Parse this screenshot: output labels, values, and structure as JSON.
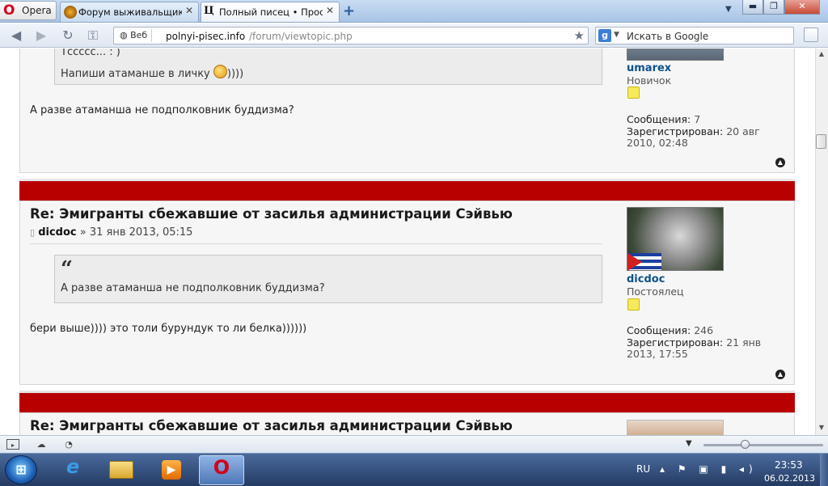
{
  "browser": {
    "menu_label": "Opera",
    "tabs": [
      {
        "title": "Форум выживальщик...",
        "active": false
      },
      {
        "title": "Полный писец • Прос...",
        "active": true
      }
    ],
    "window_controls": {
      "minimize": "▬",
      "restore": "❐",
      "close": "✕"
    },
    "address": {
      "web_label": "Веб",
      "host": "polnyi-pisec.info",
      "path": "/forum/viewtopic.php"
    },
    "search": {
      "placeholder": "Искать в Google"
    }
  },
  "posts": [
    {
      "quote_lines": [
        "Тссссс... : )",
        "Напиши атаманше в личку"
      ],
      "quote_suffix": "))))",
      "body": "А разве атаманша не подполковник буддизма?",
      "author": {
        "name": "umarex",
        "rank": "Новичок",
        "posts_label": "Сообщения:",
        "posts_value": "7",
        "reg_label": "Зарегистрирован:",
        "reg_value": "20 авг 2010, 02:48"
      }
    },
    {
      "title": "Re: Эмигранты сбежавшие от засилья администрации Сэйвью",
      "author_name": "dicdoc",
      "date": "» 31 янв 2013, 05:15",
      "quote_mark": "“",
      "quote": "А разве атаманша не подполковник буддизма?",
      "body": "бери выше)))) это толи бурундук то ли белка))))))",
      "author": {
        "name": "dicdoc",
        "rank": "Постоялец",
        "posts_label": "Сообщения:",
        "posts_value": "246",
        "reg_label": "Зарегистрирован:",
        "reg_value": "21 янв 2013, 17:55"
      }
    },
    {
      "title": "Re: Эмигранты сбежавшие от засилья администрации Сэйвью"
    }
  ],
  "taskbar": {
    "start_glyph": "⊞",
    "language": "RU",
    "time": "23:53",
    "date": "06.02.2013"
  },
  "colors": {
    "post_bar": "#b90000",
    "username": "#105289",
    "opera_red": "#d2001a"
  }
}
